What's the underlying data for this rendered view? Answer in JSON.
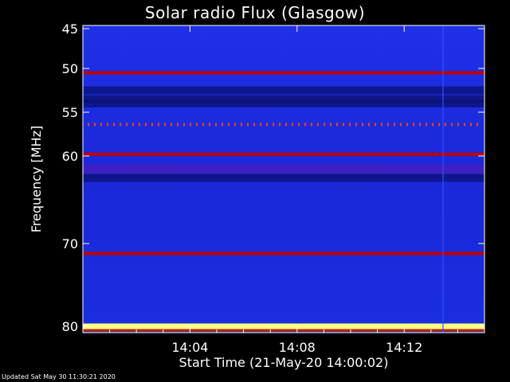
{
  "chart_data": {
    "type": "heatmap",
    "title": "Solar radio Flux (Glasgow)",
    "xlabel": "Start Time (21-May-20 14:00:02)",
    "ylabel": "Frequency [MHz]",
    "x_ticks": [
      "14:04",
      "14:08",
      "14:12"
    ],
    "x_tick_values_min": [
      4,
      8,
      12
    ],
    "xlim_min": [
      0,
      15
    ],
    "y_ticks": [
      45,
      50,
      55,
      60,
      70,
      80
    ],
    "ylim_mhz": [
      45,
      81
    ],
    "y_scale": "log-like (non-linear frequency axis)",
    "grid": false,
    "background_color": "#1a2ee0",
    "bright_bands_mhz": [
      {
        "freq": 50.5,
        "color": "#c00000",
        "intensity": "medium"
      },
      {
        "freq": 56.4,
        "color": "#ff4000",
        "intensity": "pulsed"
      },
      {
        "freq": 59.8,
        "color": "#c00000",
        "intensity": "high"
      },
      {
        "freq": 61.5,
        "color": "#5a1ab0",
        "intensity": "low"
      },
      {
        "freq": 71.2,
        "color": "#c00000",
        "intensity": "high"
      },
      {
        "freq": 80.0,
        "color": "#ffff80",
        "intensity": "saturated"
      }
    ],
    "dark_bands_mhz": [
      52.5,
      53.5,
      54.0,
      62.5
    ]
  },
  "footer": {
    "updated": "Updated Sat May 30 11:30:21 2020"
  },
  "colors": {
    "axis": "#ffffff",
    "plot_blue": "#1a2ee0",
    "dark_blue": "#0a1070",
    "red": "#c00000",
    "yellow": "#ffff60"
  }
}
